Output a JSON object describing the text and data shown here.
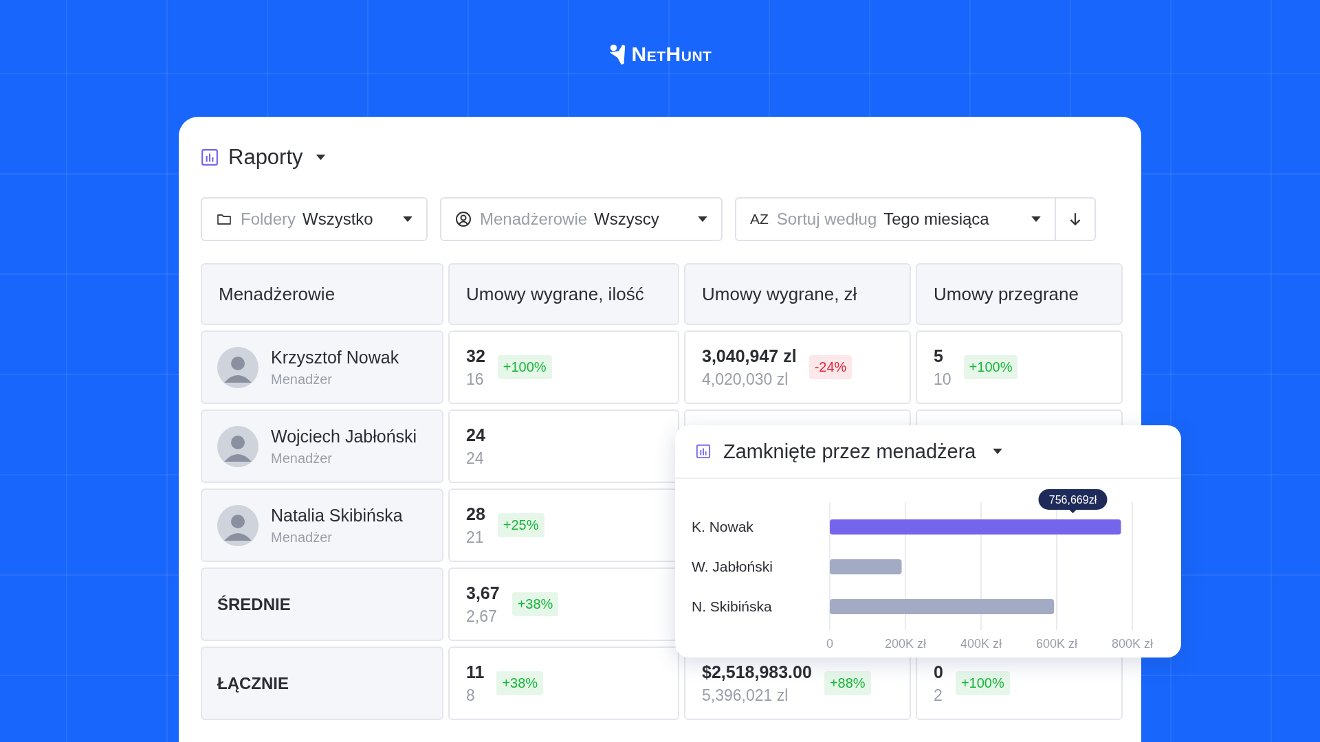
{
  "brand": {
    "name": "NetHunt"
  },
  "report": {
    "title": "Raporty"
  },
  "filters": [
    {
      "kind": "folder",
      "label": "Foldery",
      "value": "Wszystko"
    },
    {
      "kind": "user",
      "label": "Menadżerowie",
      "value": "Wszyscy"
    },
    {
      "kind": "sort",
      "icon_text": "AZ",
      "label": "Sortuj według",
      "value": "Tego miesiąca"
    }
  ],
  "table": {
    "columns": [
      "Menadżerowie",
      "Umowy wygrane, ilość",
      "Umowy wygrane, zł",
      "Umowy przegrane"
    ],
    "rows": [
      {
        "kind": "person",
        "cells": [
          {
            "name": "Krzysztof Nowak",
            "role": "Menadżer"
          },
          {
            "current": "32",
            "previous": "16",
            "change": "+100%",
            "color": "#17b53a"
          },
          {
            "current": "3,040,947 zl",
            "previous": "4,020,030 zl",
            "change": "-24%",
            "color": "#e3263b"
          },
          {
            "current": "5",
            "previous": "10",
            "change": "+100%",
            "color": "#17b53a"
          }
        ]
      },
      {
        "kind": "person",
        "cells": [
          {
            "name": "Wojciech Jabłoński",
            "role": "Menadżer"
          },
          {
            "current": "24",
            "previous": "24"
          },
          null,
          null
        ]
      },
      {
        "kind": "person",
        "cells": [
          {
            "name": "Natalia Skibińska",
            "role": "Menadżer"
          },
          {
            "current": "28",
            "previous": "21",
            "change": "+25%",
            "color": "#17b53a"
          }
        ]
      },
      {
        "kind": "summary",
        "cells": [
          {
            "name": "ŚREDNIE"
          },
          {
            "current": "3,67",
            "previous": "2,67",
            "change": "+38%",
            "color": "#17b53a"
          }
        ]
      },
      {
        "kind": "summary",
        "cells": [
          {
            "name": "ŁĄCZNIE"
          },
          {
            "current": "11",
            "previous": "8",
            "change": "+38%",
            "color": "#17b53a"
          },
          {
            "current": "$2,518,983.00",
            "previous": "5,396,021 zl",
            "change": "+88%",
            "color": "#17b53a"
          },
          {
            "current": "0",
            "previous": "2",
            "change": "+100%",
            "color": "#17b53a"
          }
        ]
      }
    ]
  },
  "popup": {
    "title": "Zamknięte przez menadżera",
    "chart_data": {
      "type": "bar",
      "orientation": "horizontal",
      "grid": true,
      "categories": [
        "K. Nowak",
        "W. Jabłoński",
        "N. Skibińska"
      ],
      "series": [
        {
          "color": "#7465ea",
          "values": [
            770000,
            null,
            null
          ]
        },
        {
          "color": "#a3aac4",
          "values": [
            null,
            190000,
            593000
          ]
        }
      ],
      "xlim": [
        0,
        800000
      ],
      "xticks": [
        {
          "value": 0,
          "label": "0"
        },
        {
          "value": 200000,
          "label": "200K zł"
        },
        {
          "value": 400000,
          "label": "400K zł"
        },
        {
          "value": 600000,
          "label": "600K zł"
        },
        {
          "value": 800000,
          "label": "800K zł"
        }
      ],
      "annotations": [
        "756,669zł"
      ]
    }
  }
}
